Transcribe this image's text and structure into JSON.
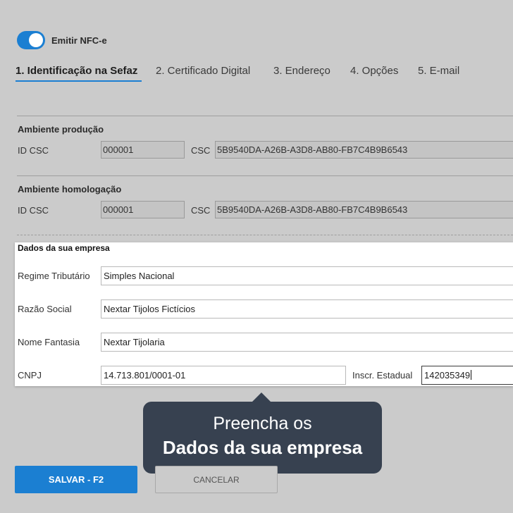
{
  "nfce_toggle": {
    "label": "Emitir NFC-e",
    "on": true
  },
  "tabs": [
    {
      "label": "1. Identificação na Sefaz",
      "active": true
    },
    {
      "label": "2. Certificado Digital",
      "active": false
    },
    {
      "label": "3. Endereço",
      "active": false
    },
    {
      "label": "4. Opções",
      "active": false
    },
    {
      "label": "5. E-mail",
      "active": false
    }
  ],
  "producao": {
    "title": "Ambiente produção",
    "id_csc_label": "ID CSC",
    "id_csc_value": "000001",
    "csc_label": "CSC",
    "csc_value": "5B9540DA-A26B-A3D8-AB80-FB7C4B9B6543"
  },
  "homologacao": {
    "title": "Ambiente homologação",
    "id_csc_label": "ID CSC",
    "id_csc_value": "000001",
    "csc_label": "CSC",
    "csc_value": "5B9540DA-A26B-A3D8-AB80-FB7C4B9B6543"
  },
  "empresa": {
    "title": "Dados da sua empresa",
    "regime_label": "Regime Tributário",
    "regime_value": "Simples Nacional",
    "razao_label": "Razão Social",
    "razao_value": "Nextar Tijolos Fictícios",
    "fantasia_label": "Nome Fantasia",
    "fantasia_value": "Nextar Tijolaria",
    "cnpj_label": "CNPJ",
    "cnpj_value": "14.713.801/0001-01",
    "ie_label": "Inscr. Estadual",
    "ie_value": "142035349"
  },
  "tooltip": {
    "line1": "Preencha os",
    "line2": "Dados da sua empresa"
  },
  "actions": {
    "save_label": "SALVAR - F2",
    "cancel_label": "CANCELAR"
  },
  "colors": {
    "accent": "#1b7fd2",
    "tooltip_bg": "#374150",
    "page_bg": "#cbcbcb"
  }
}
